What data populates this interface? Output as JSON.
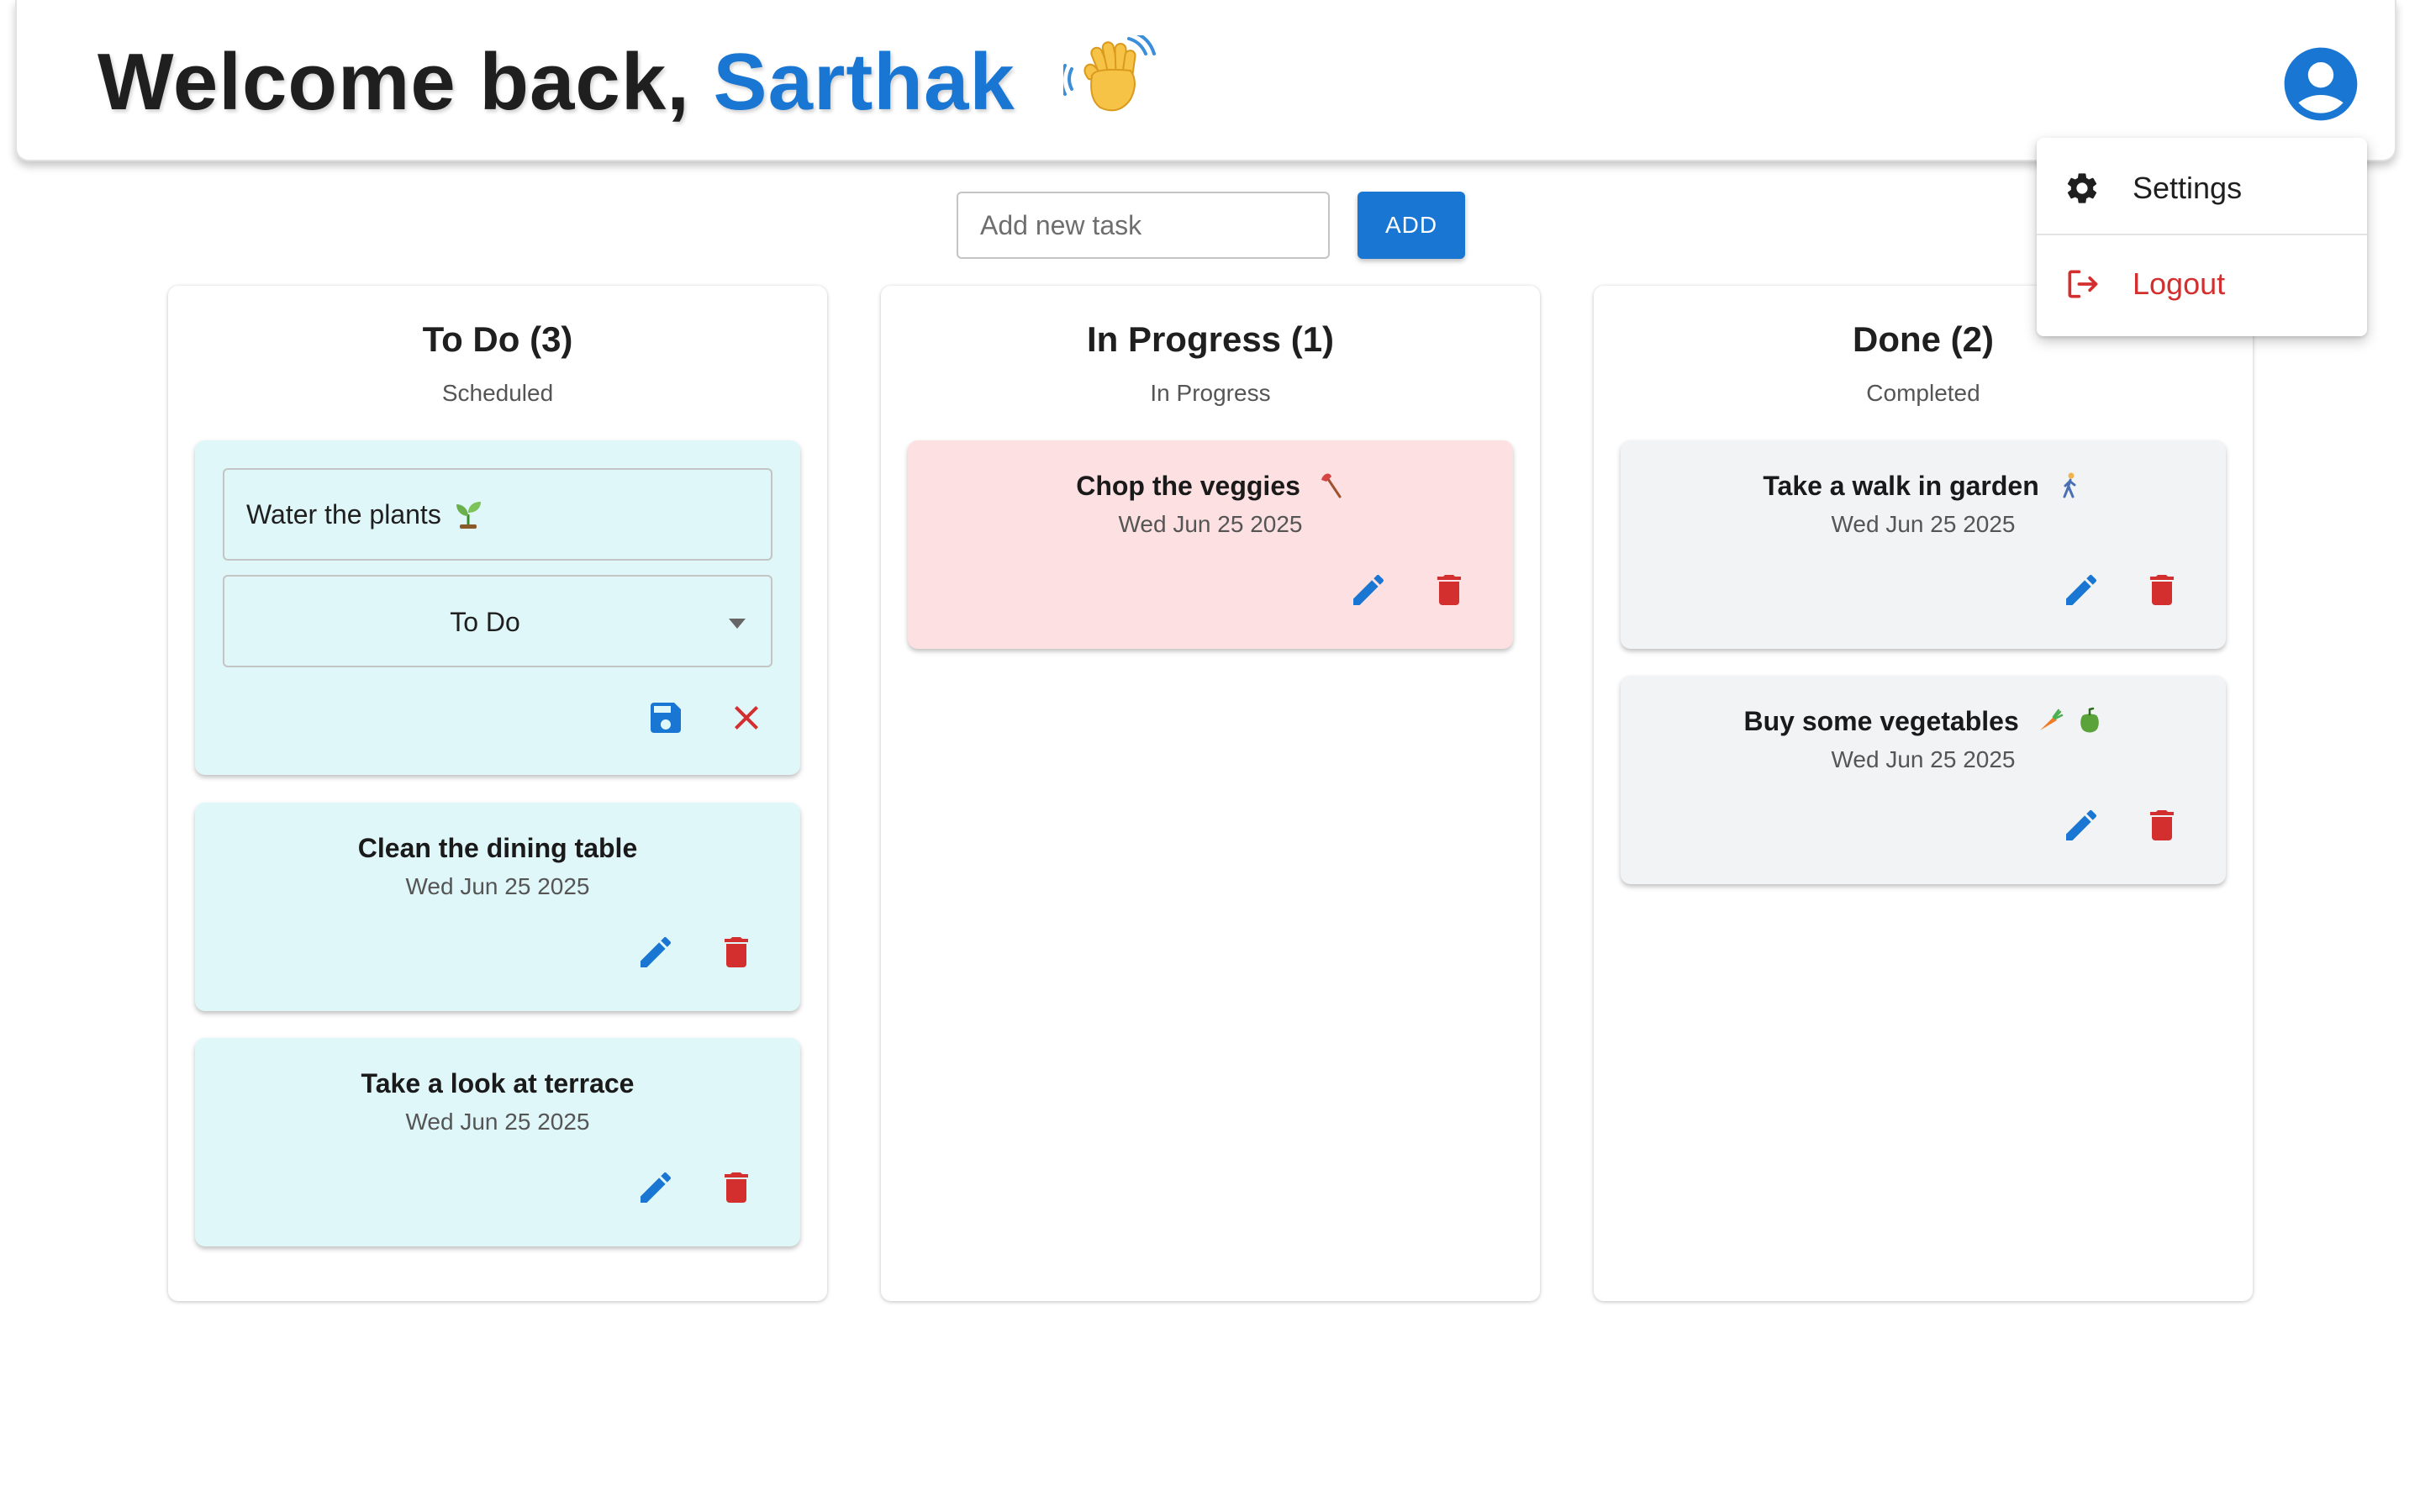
{
  "header": {
    "greeting": "Welcome back,",
    "username": "Sarthak"
  },
  "user_menu": {
    "items": [
      {
        "label": "Settings",
        "icon": "gear-icon"
      },
      {
        "label": "Logout",
        "icon": "logout-icon"
      }
    ]
  },
  "add_task": {
    "placeholder": "Add new task",
    "button_label": "ADD"
  },
  "columns": [
    {
      "title": "To Do (3)",
      "subtitle": "Scheduled",
      "editing": {
        "name": "Water the plants",
        "status": "To Do"
      },
      "cards": [
        {
          "title": "Clean the dining table",
          "date": "Wed Jun 25 2025"
        },
        {
          "title": "Take a look at terrace",
          "date": "Wed Jun 25 2025"
        }
      ]
    },
    {
      "title": "In Progress (1)",
      "subtitle": "In Progress",
      "cards": [
        {
          "title": "Chop the veggies",
          "date": "Wed Jun 25 2025"
        }
      ]
    },
    {
      "title": "Done (2)",
      "subtitle": "Completed",
      "cards": [
        {
          "title": "Take a walk in garden",
          "date": "Wed Jun 25 2025"
        },
        {
          "title": "Buy some vegetables",
          "date": "Wed Jun 25 2025"
        }
      ]
    }
  ],
  "colors": {
    "accent": "#1976d2",
    "danger": "#d32f2f",
    "todo_card": "#e0f7fa",
    "progress_card": "#fde0e2",
    "done_card": "#f2f3f5"
  }
}
